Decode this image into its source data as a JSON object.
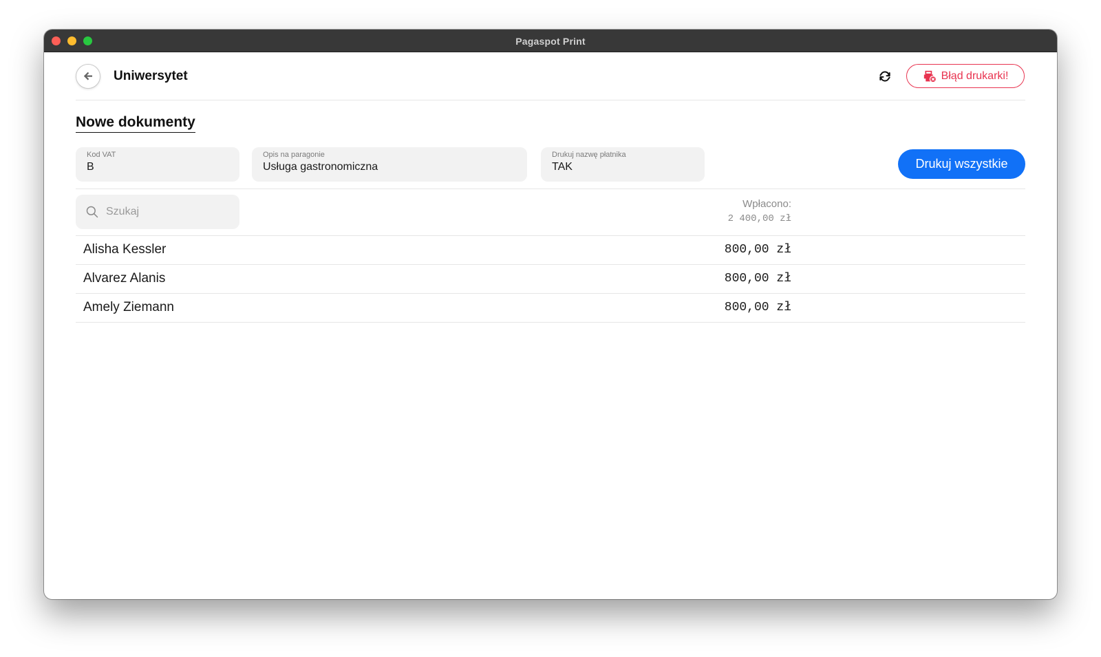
{
  "window": {
    "title": "Pagaspot Print"
  },
  "header": {
    "title": "Uniwersytet",
    "printer_error": "Błąd drukarki!"
  },
  "section": {
    "title": "Nowe dokumenty"
  },
  "fields": {
    "vat": {
      "label": "Kod VAT",
      "value": "B"
    },
    "description": {
      "label": "Opis na paragonie",
      "value": "Usługa gastronomiczna"
    },
    "payer": {
      "label": "Drukuj nazwę płatnika",
      "value": "TAK"
    }
  },
  "print_all_label": "Drukuj wszystkie",
  "search": {
    "placeholder": "Szukaj",
    "value": ""
  },
  "summary": {
    "label": "Wpłacono:",
    "total": "2 400,00 zł"
  },
  "rows": [
    {
      "name": "Alisha Kessler",
      "amount": "800,00 zł"
    },
    {
      "name": "Alvarez Alanis",
      "amount": "800,00 zł"
    },
    {
      "name": "Amely Ziemann",
      "amount": "800,00 zł"
    }
  ],
  "colors": {
    "accent": "#1171f7",
    "error": "#e8334f",
    "field_bg": "#f2f2f2"
  },
  "icons": [
    "arrow-left-icon",
    "refresh-icon",
    "printer-off-icon",
    "search-icon"
  ]
}
